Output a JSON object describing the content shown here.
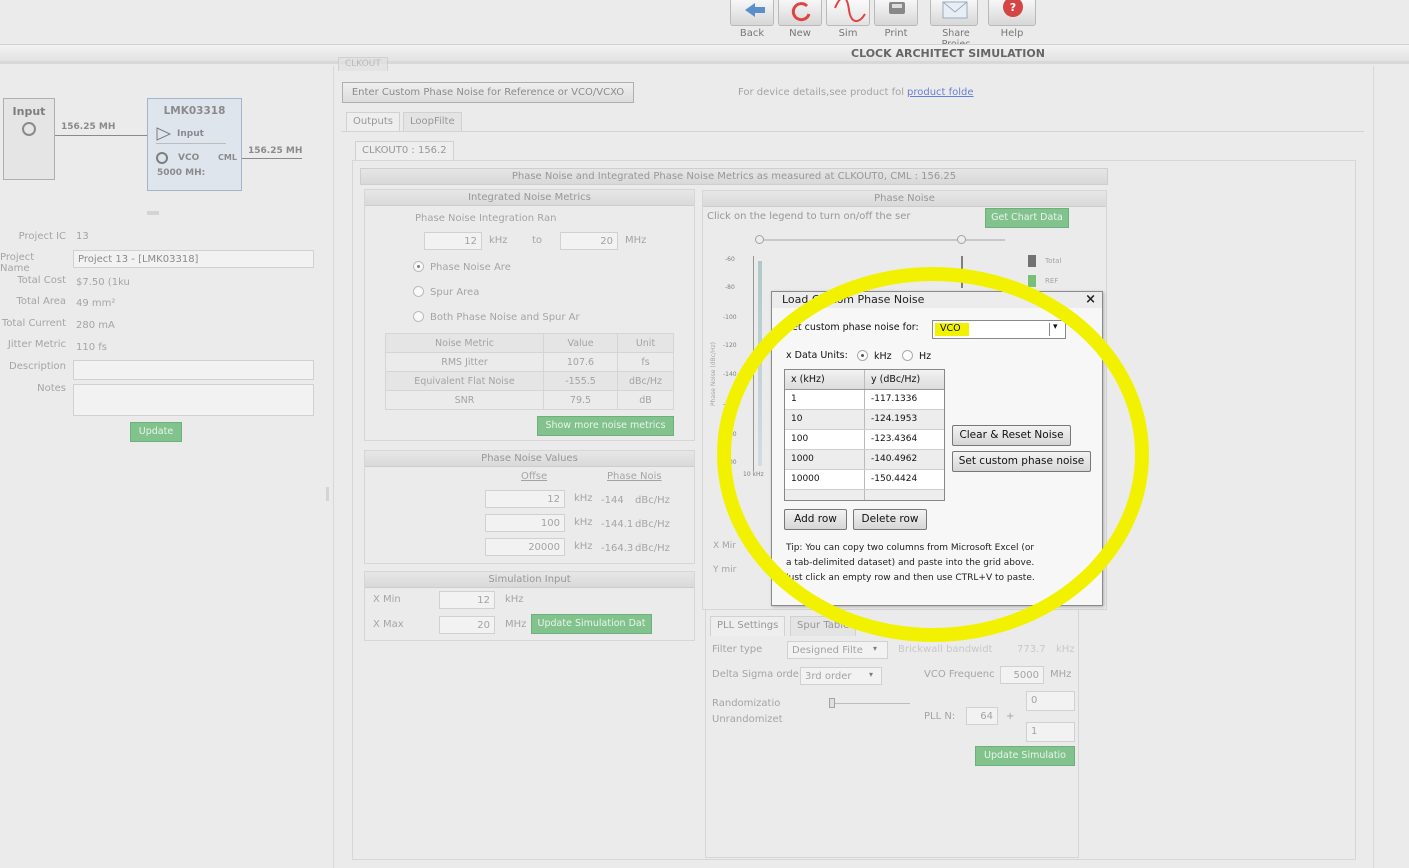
{
  "toolbar": {
    "items": [
      {
        "label": "Back",
        "icon": "back-arrow-icon"
      },
      {
        "label": "New",
        "icon": "refresh-icon"
      },
      {
        "label": "Sim",
        "icon": "sine-wave-icon"
      },
      {
        "label": "Print",
        "icon": "printer-icon"
      },
      {
        "label": "Share Projec",
        "icon": "envelope-icon"
      },
      {
        "label": "Help",
        "icon": "help-icon"
      }
    ],
    "app_title": "CLOCK ARCHITECT SIMULATION"
  },
  "diagram": {
    "input_label": "Input",
    "input_freq": "156.25 MH",
    "device_name": "LMK03318",
    "device_input": "Input",
    "vco_label": "VCO",
    "cml_label": "CML",
    "vco_freq": "5000 MH:",
    "output_freq": "156.25 MH"
  },
  "project": {
    "fields": [
      {
        "label": "Project IC",
        "value": "13"
      },
      {
        "label": "Project Name",
        "value": "Project 13 - [LMK03318]"
      },
      {
        "label": "Total Cost",
        "value": "$7.50 (1ku"
      },
      {
        "label": "Total Area",
        "value": "49 mm²"
      },
      {
        "label": "Total Current",
        "value": "280 mA"
      },
      {
        "label": "Jitter Metric",
        "value": "110 fs"
      },
      {
        "label": "Description",
        "value": ""
      },
      {
        "label": "Notes",
        "value": ""
      }
    ],
    "update_label": "Update"
  },
  "main": {
    "top_tab": "CLKOUT",
    "custom_noise_button": "Enter Custom Phase Noise for Reference or VCO/VCXO",
    "device_details_text": "For device details,see product fol",
    "device_details_link": "product folde",
    "tabs": [
      "Outputs",
      "LoopFilte"
    ],
    "output_tab": "CLKOUT0 : 156.2",
    "section_title": "Phase Noise and Integrated Phase Noise Metrics as measured at CLKOUT0, CML : 156.25"
  },
  "metrics": {
    "title": "Integrated Noise Metrics",
    "range_label": "Phase Noise Integration Ran",
    "from_value": "12",
    "from_unit": "kHz",
    "to_label": "to",
    "to_value": "20",
    "to_unit": "MHz",
    "options": [
      "Phase Noise Are",
      "Spur Area",
      "Both Phase Noise and Spur Ar"
    ],
    "table_headers": [
      "Noise Metric",
      "Value",
      "Unit"
    ],
    "table_rows": [
      [
        "RMS Jitter",
        "107.6",
        "fs"
      ],
      [
        "Equivalent Flat Noise",
        "-155.5",
        "dBc/Hz"
      ],
      [
        "SNR",
        "79.5",
        "dB"
      ]
    ],
    "show_more_label": "Show more noise metrics"
  },
  "pn_values": {
    "title": "Phase Noise Values",
    "offset_header": "Offse",
    "pn_header": "Phase Nois",
    "rows": [
      {
        "offset": "12",
        "unit": "kHz",
        "pn": "-144",
        "pn_unit": "dBc/Hz"
      },
      {
        "offset": "100",
        "unit": "kHz",
        "pn": "-144.1",
        "pn_unit": "dBc/Hz"
      },
      {
        "offset": "20000",
        "unit": "kHz",
        "pn": "-164.3",
        "pn_unit": "dBc/Hz"
      }
    ]
  },
  "sim_input": {
    "title": "Simulation Input",
    "xmin_label": "X Min",
    "xmin_value": "12",
    "xmin_unit": "kHz",
    "xmax_label": "X Max",
    "xmax_value": "20",
    "xmax_unit": "MHz",
    "update_label": "Update Simulation Dat"
  },
  "phase_noise_chart": {
    "title": "Phase Noise",
    "hint": "Click on the legend to turn on/off the ser",
    "get_chart_label": "Get Chart Data",
    "y_axis_label": "Phase Noise (dBc/Hz)",
    "y_ticks": [
      "-60",
      "-80",
      "-100",
      "-120",
      "-140",
      "-160",
      "-180",
      "-200"
    ],
    "x_tick": "10 kHz",
    "legend": [
      {
        "name": "Total",
        "color": "#444444"
      },
      {
        "name": "REF",
        "color": "#4caf50"
      }
    ],
    "xmin_label": "X Mir",
    "ymin_label": "Y mir"
  },
  "pll": {
    "tabs": [
      "PLL Settings",
      "Spur Table"
    ],
    "filter_type_label": "Filter type",
    "filter_type_value": "Designed Filte",
    "brickwall_label": "Brickwall bandwidt",
    "brickwall_value": "773.7",
    "brickwall_unit": "kHz",
    "ds_order_label": "Delta Sigma orde",
    "ds_order_value": "3rd order",
    "vco_freq_label": "VCO Frequenc",
    "vco_freq_value": "5000",
    "vco_freq_unit": "MHz",
    "randomization_label": "Randomizatio",
    "unrandomized_label": "Unrandomizet",
    "plln_label": "PLL N:",
    "plln_value": "64",
    "plus": "+",
    "num_value": "0",
    "den_value": "1",
    "update_label": "Update Simulatio"
  },
  "dialog": {
    "title": "Load Custom Phase Noise",
    "close": "×",
    "set_for_label": "Set custom phase noise for:",
    "set_for_value": "VCO",
    "units_label": "x Data Units:",
    "unit_khz": "kHz",
    "unit_hz": "Hz",
    "col_x": "x (kHz)",
    "col_y": "y (dBc/Hz)",
    "rows": [
      {
        "x": "1",
        "y": "-117.1336"
      },
      {
        "x": "10",
        "y": "-124.1953"
      },
      {
        "x": "100",
        "y": "-123.4364"
      },
      {
        "x": "1000",
        "y": "-140.4962"
      },
      {
        "x": "10000",
        "y": "-150.4424"
      }
    ],
    "clear_label": "Clear & Reset Noise",
    "set_label": "Set custom phase noise",
    "add_row_label": "Add row",
    "delete_row_label": "Delete row",
    "tip_lines": [
      "Tip: You can copy two columns from Microsoft Excel (or",
      "a tab-delimited dataset) and paste into the grid above.",
      "Just click an empty row and then use CTRL+V to paste."
    ],
    "highlight_color": "#f2f200"
  }
}
